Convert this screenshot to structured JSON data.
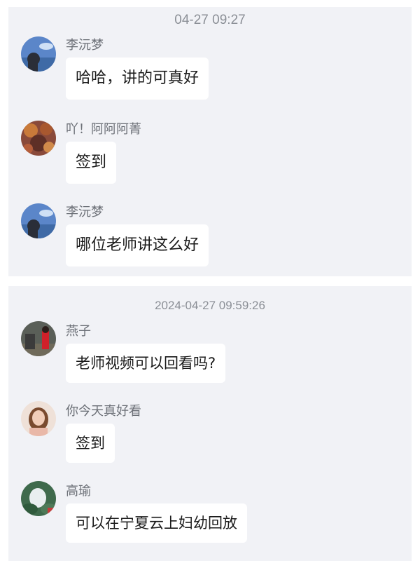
{
  "section1": {
    "timestamp": "04-27 09:27",
    "messages": [
      {
        "sender": "李沅梦",
        "text": "哈哈，讲的可真好"
      },
      {
        "sender": "吖！阿阿阿菁",
        "text": "签到"
      },
      {
        "sender": "李沅梦",
        "text": "哪位老师讲这么好"
      }
    ]
  },
  "section2": {
    "timestamp": "2024-04-27 09:59:26",
    "messages": [
      {
        "sender": "燕子",
        "text": "老师视频可以回看吗?"
      },
      {
        "sender": "你今天真好看",
        "text": "签到"
      },
      {
        "sender": "高瑜",
        "text": "可以在宁夏云上妇幼回放"
      }
    ]
  },
  "colors": {
    "panel_background": "#f1f2f6",
    "bubble_background": "#ffffff",
    "timestamp_text": "#8b8f96",
    "sender_text": "#6b6f76",
    "message_text": "#1a1a1a"
  }
}
